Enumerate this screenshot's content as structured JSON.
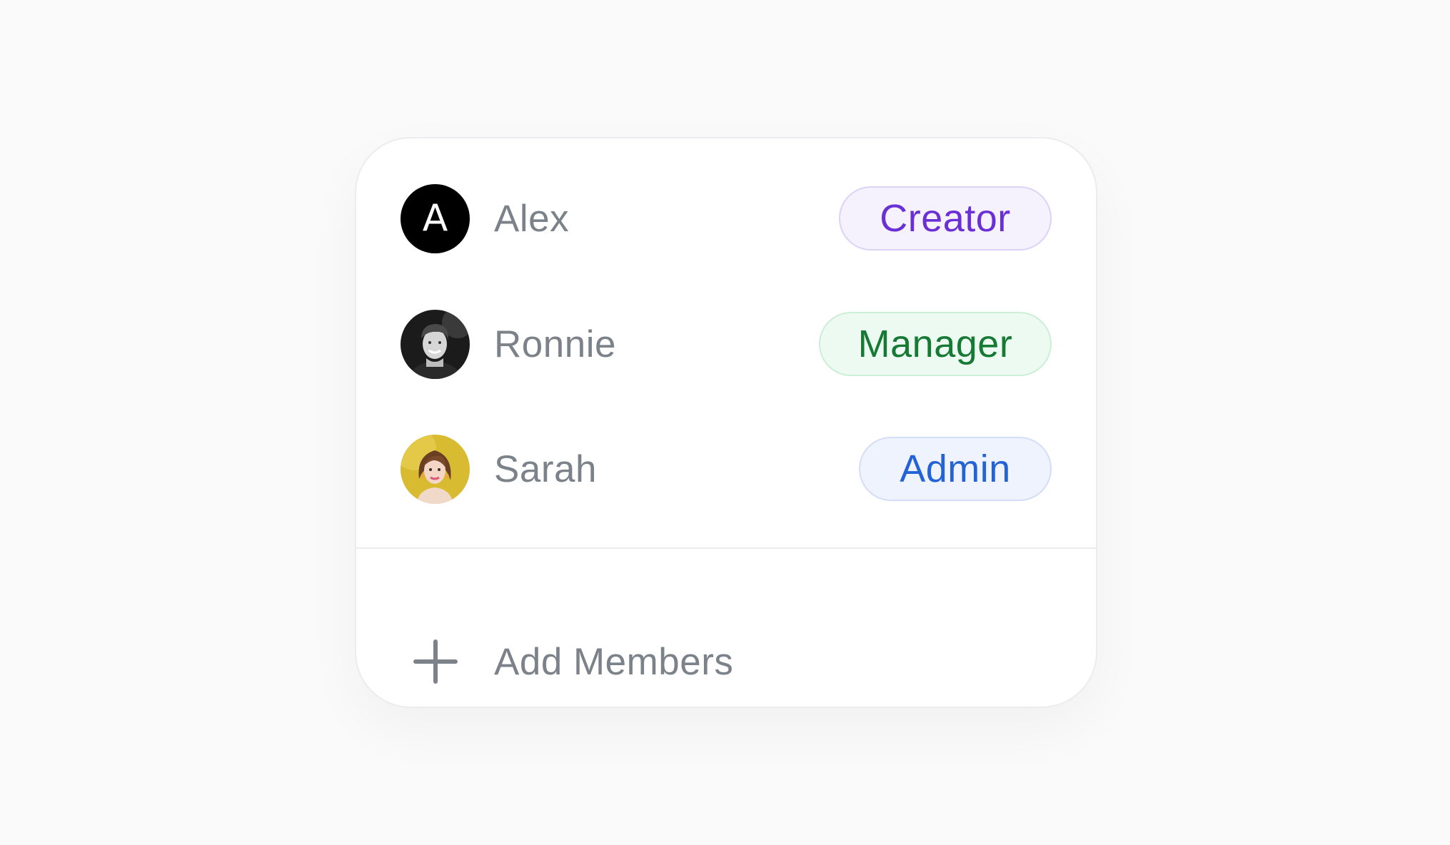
{
  "members": [
    {
      "name": "Alex",
      "avatar_initial": "A",
      "avatar_type": "initial",
      "role": "Creator",
      "role_color": "#6b2fd6",
      "role_bg": "#f5f1fd",
      "role_border": "#ddd3f6"
    },
    {
      "name": "Ronnie",
      "avatar_type": "photo",
      "avatar_desc": "man-photo",
      "role": "Manager",
      "role_color": "#167a35",
      "role_bg": "#edfaf1",
      "role_border": "#cdeed7"
    },
    {
      "name": "Sarah",
      "avatar_type": "photo",
      "avatar_desc": "woman-photo",
      "role": "Admin",
      "role_color": "#2463d6",
      "role_bg": "#eef3fd",
      "role_border": "#d4def6"
    }
  ],
  "add_members": {
    "label": "Add Members",
    "icon": "plus-icon"
  },
  "colors": {
    "background": "#fafafa",
    "card": "#ffffff",
    "muted_text": "#7b8289"
  }
}
